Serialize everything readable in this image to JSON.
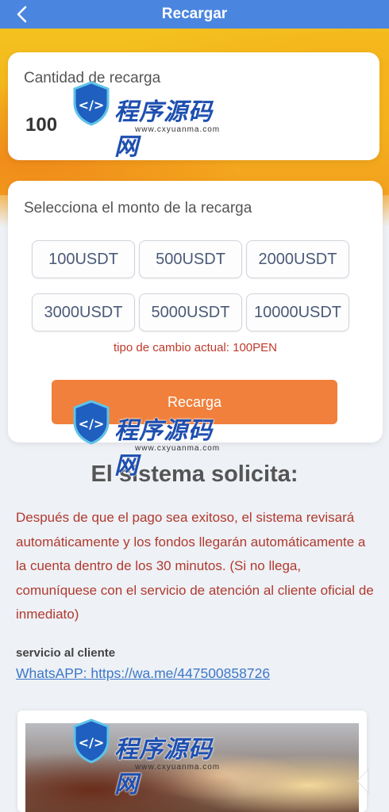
{
  "header": {
    "title": "Recargar",
    "back_icon": "chevron-left-icon"
  },
  "amount_card": {
    "label": "Cantidad de recarga",
    "value": "100"
  },
  "select_card": {
    "label": "Selecciona el monto de la recarga",
    "options": [
      "100USDT",
      "500USDT",
      "2000USDT",
      "3000USDT",
      "5000USDT",
      "10000USDT"
    ],
    "rate_text": "tipo de cambio actual: 100PEN",
    "button_label": "Recarga"
  },
  "system": {
    "title": "El sistema solicita:",
    "description": "Después de que el pago sea exitoso, el sistema revisará automáticamente y los fondos llegarán automáticamente a la cuenta dentro de los 30 minutos. (Si no llega, comuníquese con el servicio de atención al cliente oficial de inmediato)"
  },
  "customer_service": {
    "label": "servicio al cliente",
    "link": "WhatsAPP: https://wa.me/447500858726"
  },
  "watermark": {
    "title": "程序源码网",
    "url": "www.cxyuanma.com"
  },
  "colors": {
    "header_blue": "#4a86e0",
    "button_orange": "#f0803c",
    "alert_red": "#b03a2e",
    "link_blue": "#3d78c8"
  }
}
